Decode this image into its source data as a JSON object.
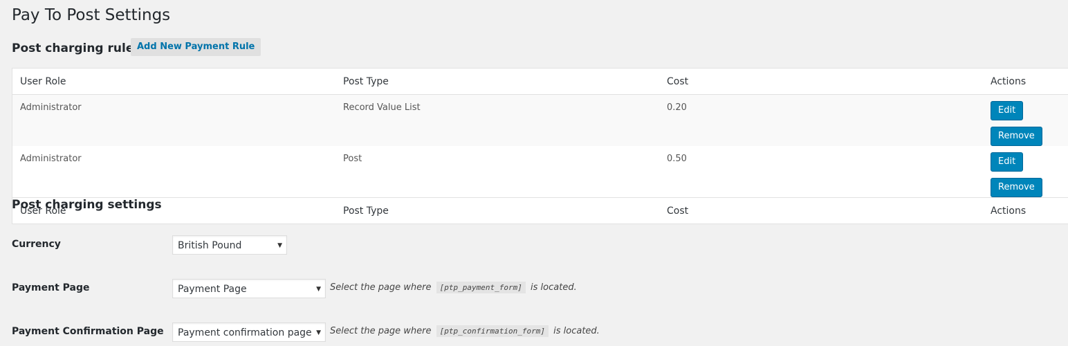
{
  "page": {
    "title": "Pay To Post Settings"
  },
  "rules": {
    "section_title": "Post charging rules",
    "add_button_label": "Add New Payment Rule",
    "columns": [
      "User Role",
      "Post Type",
      "Cost",
      "Actions"
    ],
    "rows": [
      {
        "user_role": "Administrator",
        "post_type": "Record Value List",
        "cost": "0.20"
      },
      {
        "user_role": "Administrator",
        "post_type": "Post",
        "cost": "0.50"
      }
    ],
    "edit_label": "Edit",
    "remove_label": "Remove"
  },
  "settings": {
    "section_title": "Post charging settings",
    "currency": {
      "label": "Currency",
      "selected": "British Pound"
    },
    "payment_page": {
      "label": "Payment Page",
      "selected": "Payment Page",
      "desc_before": "Select the page where",
      "shortcode": "[ptp_payment_form]",
      "desc_after": "is located."
    },
    "confirmation_page": {
      "label": "Payment Confirmation Page",
      "selected": "Payment confirmation page",
      "desc_before": "Select the page where",
      "shortcode": "[ptp_confirmation_form]",
      "desc_after": "is located."
    }
  },
  "colors": {
    "background": "#f1f1f1",
    "primary_button": "#0085ba",
    "link": "#0073aa"
  },
  "icons": {
    "select_caret": "▼"
  }
}
